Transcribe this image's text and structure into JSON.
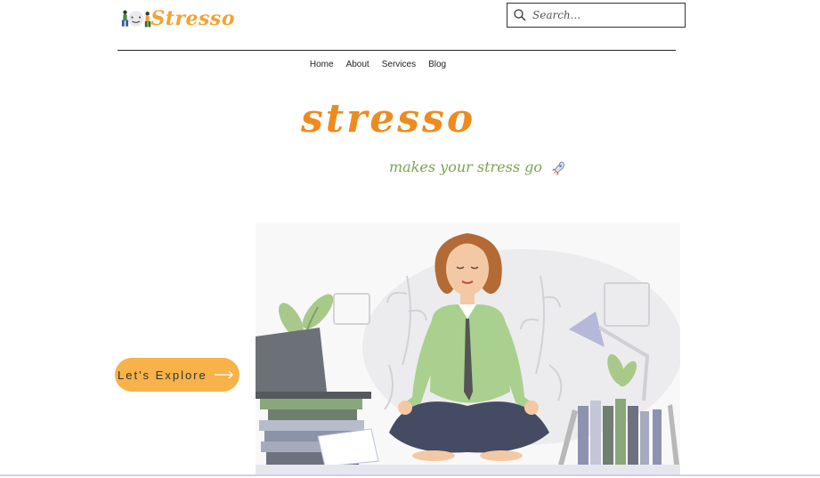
{
  "header": {
    "logo_text": "Stresso",
    "search": {
      "placeholder": "Search..."
    }
  },
  "nav": {
    "items": [
      "Home",
      "About",
      "Services",
      "Blog"
    ]
  },
  "hero": {
    "title": "stresso",
    "tagline": "makes your stress go",
    "tagline_icon": "rocket-icon"
  },
  "cta": {
    "label": "Let's Explore",
    "icon": "arrow-right-icon"
  },
  "colors": {
    "brand_orange": "#ee8b1f",
    "tagline_green": "#7aa54f",
    "button": "#f7b24a"
  }
}
